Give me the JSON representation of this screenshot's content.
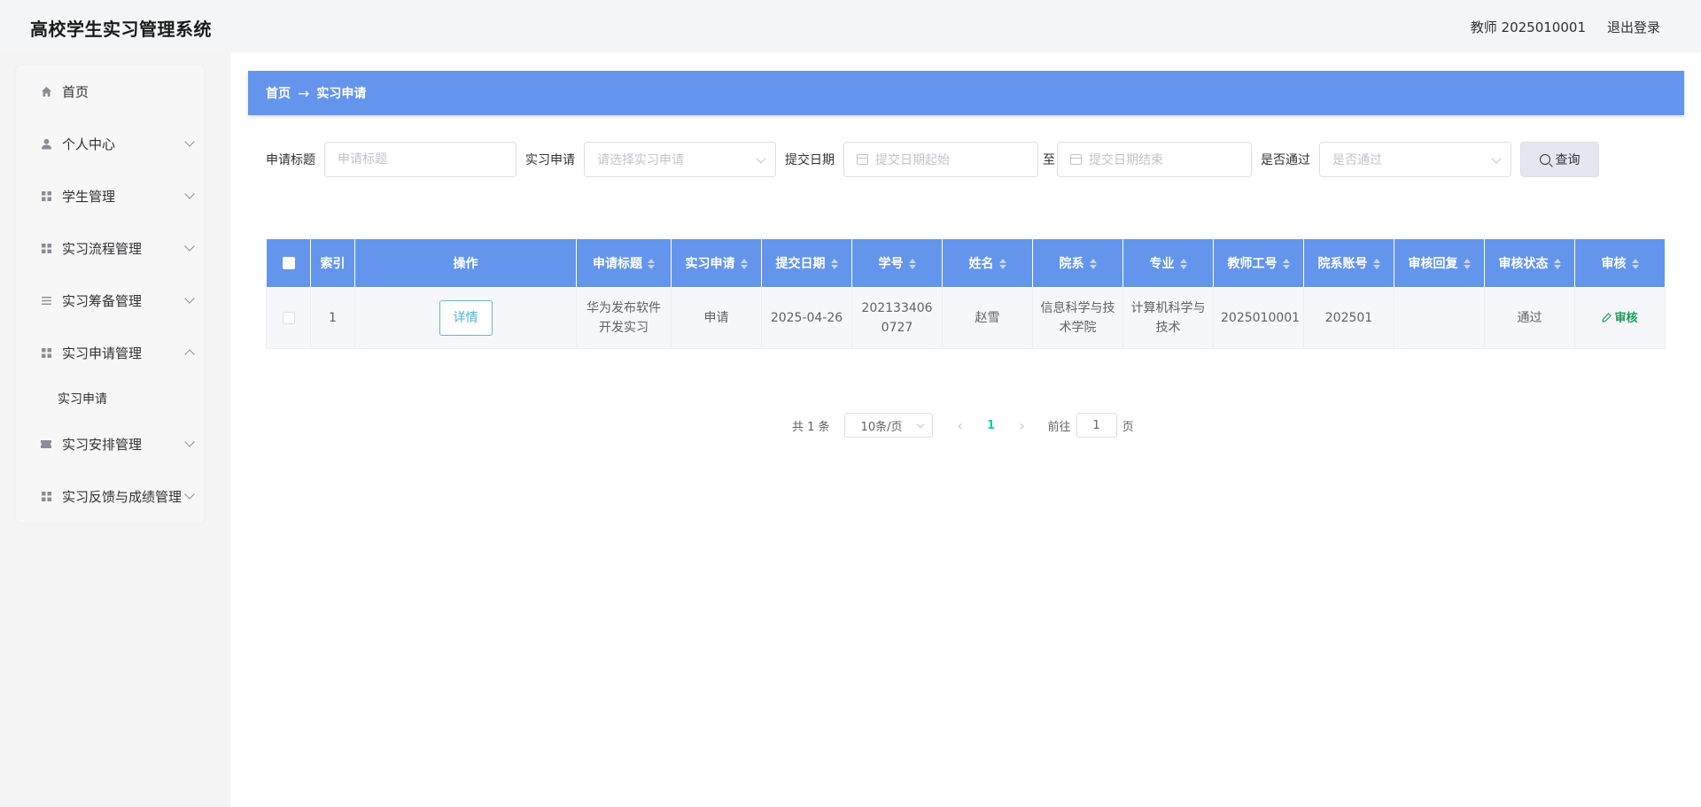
{
  "header": {
    "title": "高校学生实习管理系统",
    "user": "教师 2025010001",
    "logout": "退出登录"
  },
  "sidebar": {
    "items": [
      {
        "label": "首页",
        "icon": "home-icon"
      },
      {
        "label": "个人中心",
        "icon": "user-icon"
      },
      {
        "label": "学生管理",
        "icon": "grid-icon"
      },
      {
        "label": "实习流程管理",
        "icon": "grid-icon"
      },
      {
        "label": "实习筹备管理",
        "icon": "list-icon"
      },
      {
        "label": "实习申请管理",
        "icon": "grid-icon"
      },
      {
        "label": "实习安排管理",
        "icon": "ticket-icon"
      },
      {
        "label": "实习反馈与成绩管理",
        "icon": "grid-icon"
      }
    ],
    "sub_item": "实习申请"
  },
  "breadcrumb": {
    "home": "首页",
    "arrow": "→",
    "current": "实习申请"
  },
  "search": {
    "title_label": "申请标题",
    "title_placeholder": "申请标题",
    "type_label": "实习申请",
    "type_placeholder": "请选择实习申请",
    "date_label": "提交日期",
    "date_start_placeholder": "提交日期起始",
    "date_sep": "至",
    "date_end_placeholder": "提交日期结束",
    "pass_label": "是否通过",
    "pass_placeholder": "是否通过",
    "button": "查询"
  },
  "table": {
    "columns": [
      "索引",
      "操作",
      "申请标题",
      "实习申请",
      "提交日期",
      "学号",
      "姓名",
      "院系",
      "专业",
      "教师工号",
      "院系账号",
      "审核回复",
      "审核状态",
      "审核"
    ],
    "rows": [
      {
        "index": "1",
        "action": "详情",
        "title": "华为发布软件开发实习",
        "type": "申请",
        "date": "2025-04-26",
        "student_id": "2021334060727",
        "name": "赵雪",
        "department": "信息科学与技术学院",
        "major": "计算机科学与技术",
        "teacher_id": "2025010001",
        "dept_account": "202501",
        "reply": "",
        "status": "通过",
        "audit": "审核"
      }
    ]
  },
  "pagination": {
    "total": "共 1 条",
    "page_size": "10条/页",
    "current": "1",
    "goto_label": "前往",
    "goto_value": "1",
    "page_suffix": "页"
  }
}
